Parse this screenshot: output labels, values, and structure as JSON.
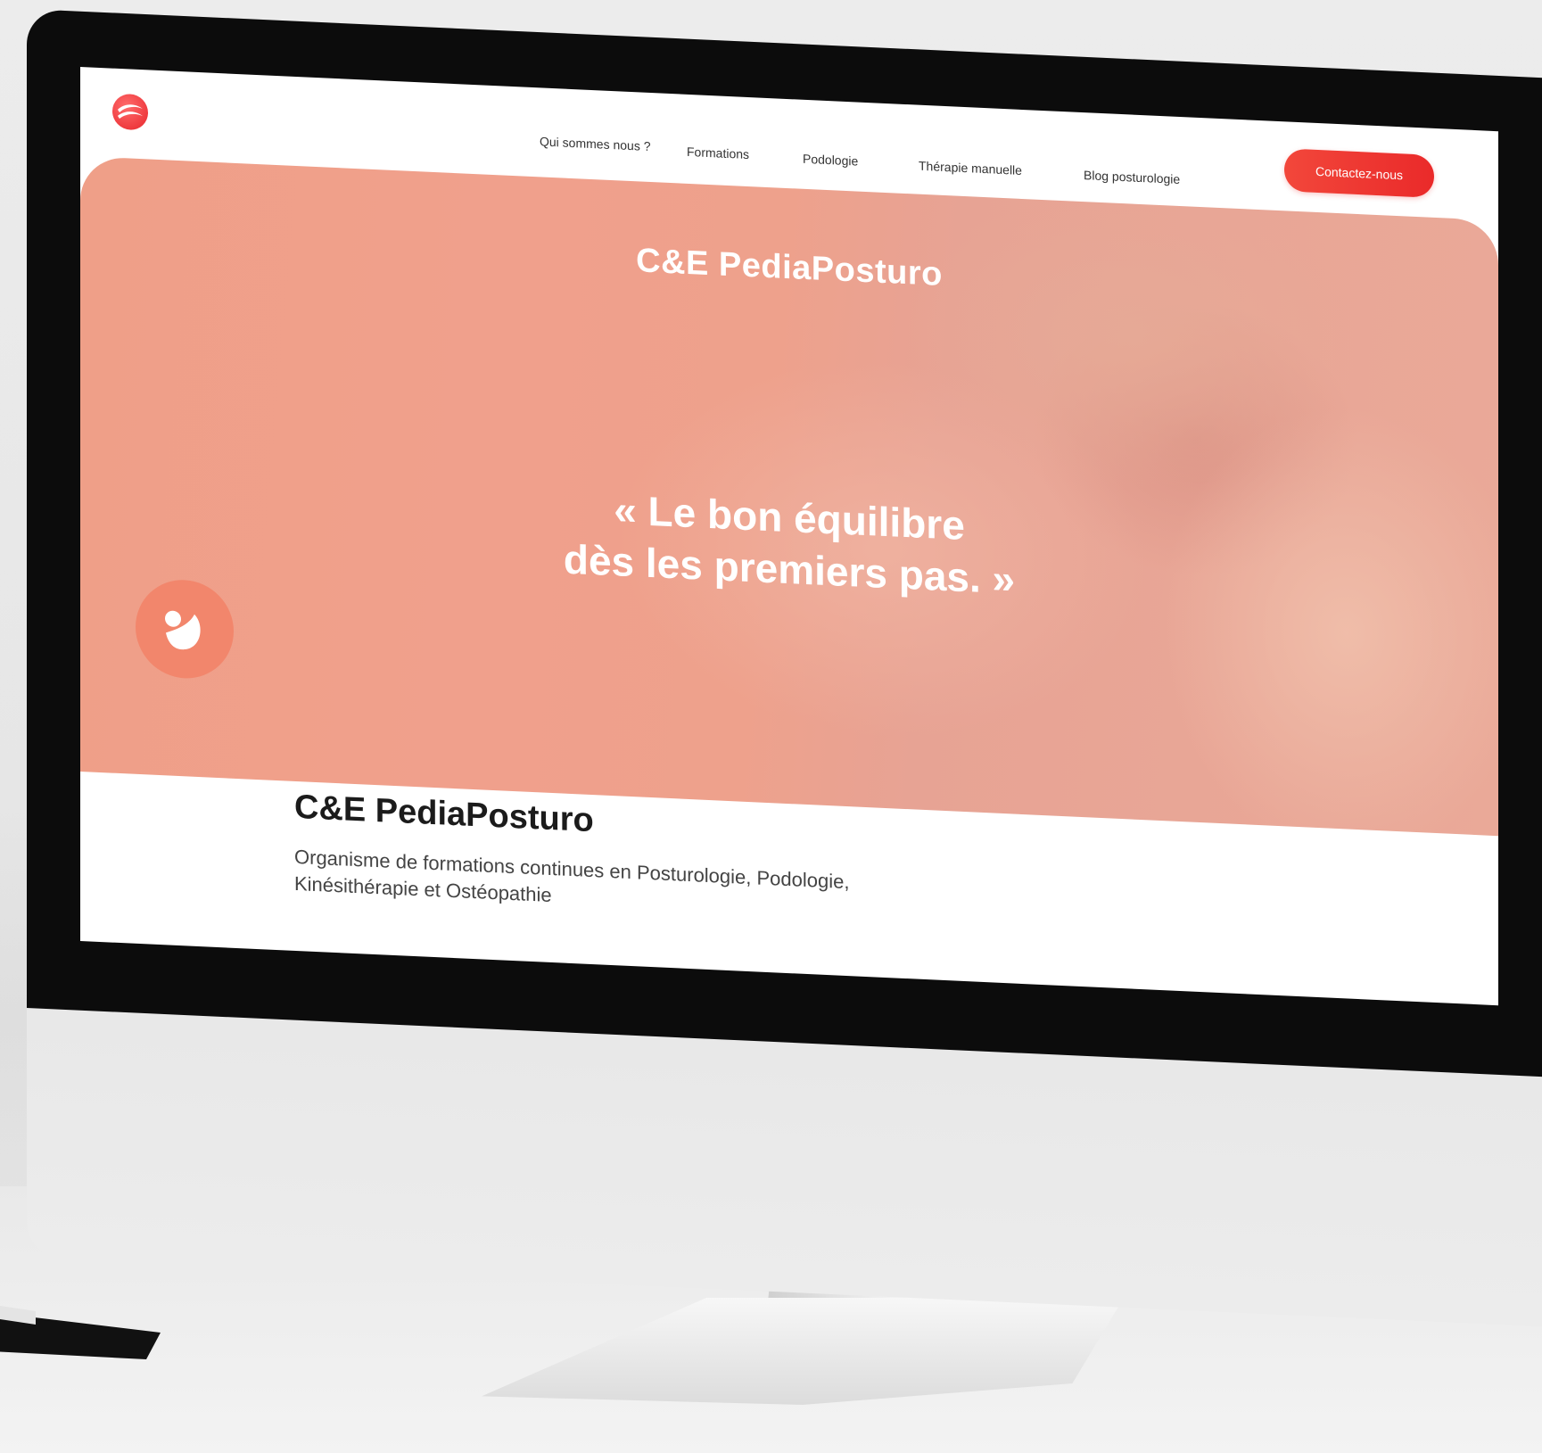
{
  "nav": {
    "items": [
      {
        "label": "Qui sommes nous ?"
      },
      {
        "label": "Formations"
      },
      {
        "label": "Podologie"
      },
      {
        "label": "Thérapie manuelle"
      },
      {
        "label": "Blog posturologie"
      }
    ],
    "cta_label": "Contactez-nous"
  },
  "hero": {
    "title": "C&E PediaPosturo",
    "quote_line1": "« Le bon équilibre",
    "quote_line2": "dès les premiers pas. »"
  },
  "about": {
    "title": "C&E PediaPosturo",
    "text": "Organisme de formations continues en Posturologie, Podologie, Kinésithérapie et Ostéopathie"
  },
  "colors": {
    "brand_red": "#ea2a2a",
    "hero_peach": "#ef9f88",
    "badge": "#f2866c"
  },
  "icons": {
    "logo": "brand-logo-icon",
    "hero_badge": "baby-silhouette-icon"
  }
}
